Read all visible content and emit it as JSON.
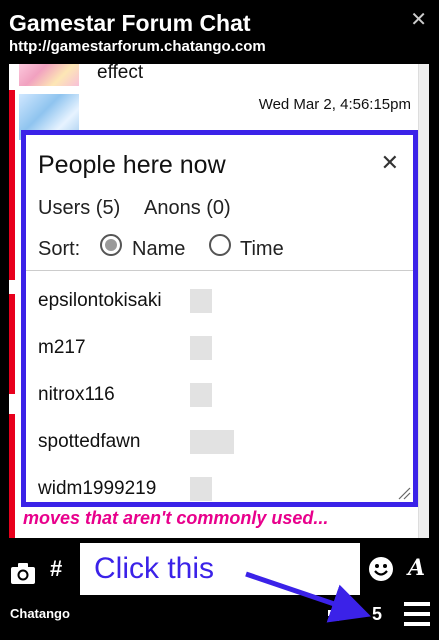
{
  "window": {
    "title": "Gamestar Forum Chat",
    "url": "http://gamestarforum.chatango.com",
    "close_glyph": "✕"
  },
  "chat": {
    "messages": [
      {
        "text": "effect"
      },
      {
        "timestamp": "Wed Mar 2, 4:56:15pm"
      }
    ],
    "last_line": "moves that aren't commonly used..."
  },
  "people_panel": {
    "title": "People here now",
    "close_glyph": "✕",
    "users_tab": "Users (5)",
    "anons_tab": "Anons (0)",
    "sort_label": "Sort:",
    "sort_options": [
      {
        "label": "Name",
        "selected": true
      },
      {
        "label": "Time",
        "selected": false
      }
    ],
    "users": [
      "epsilontokisaki",
      "m217",
      "nitrox116",
      "spottedfawn",
      "widm1999219"
    ],
    "accent_color": "#3b22e8"
  },
  "input": {
    "value": "Click this"
  },
  "toolbar": {
    "camera_icon": "camera-icon",
    "hash_label": "#",
    "smiley_icon": "smiley-icon",
    "font_label": "A",
    "brand": "Chatango",
    "user_count": "5",
    "menu_icon": "hamburger-menu-icon"
  }
}
